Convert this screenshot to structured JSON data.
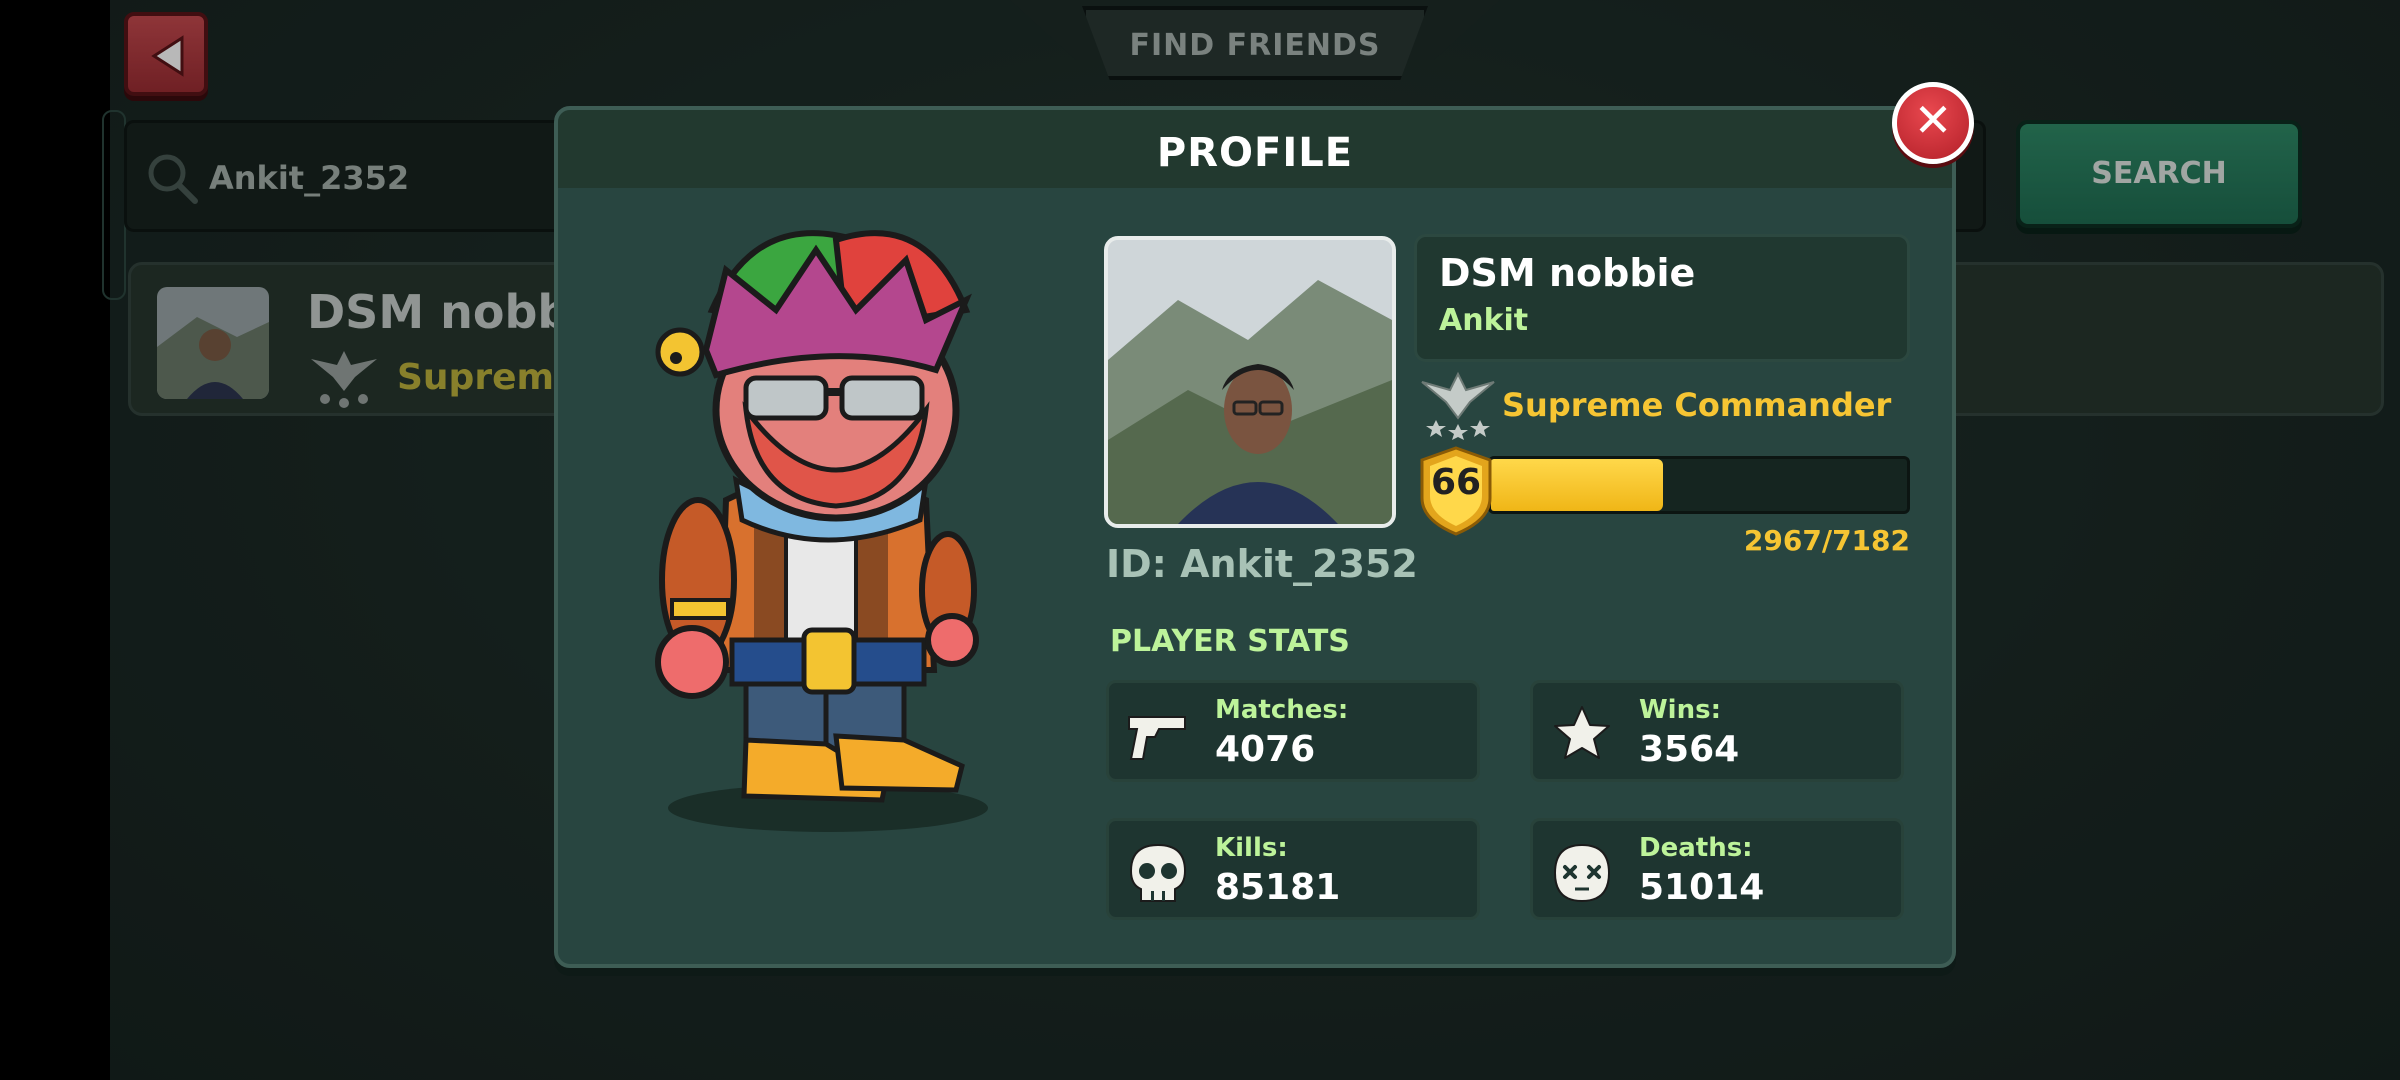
{
  "screen": {
    "title": "FIND FRIENDS",
    "search": {
      "value": "Ankit_2352",
      "button_label": "SEARCH"
    },
    "result": {
      "name": "DSM nobb",
      "rank": "Supreme"
    }
  },
  "profile": {
    "title": "PROFILE",
    "display_name": "DSM nobbie",
    "username": "Ankit",
    "player_id": "ID: Ankit_2352",
    "rank_title": "Supreme Commander",
    "level": "66",
    "xp_text": "2967/7182",
    "xp_fraction": 0.413,
    "stats_title": "PLAYER STATS",
    "stats": [
      {
        "label": "Matches:",
        "value": "4076",
        "icon": "pistol-icon"
      },
      {
        "label": "Wins:",
        "value": "3564",
        "icon": "star-icon"
      },
      {
        "label": "Kills:",
        "value": "85181",
        "icon": "skull-icon"
      },
      {
        "label": "Deaths:",
        "value": "51014",
        "icon": "dead-face-icon"
      }
    ]
  },
  "colors": {
    "accent_green": "#bdf39a",
    "gold": "#f6c533",
    "close_red": "#d7363e",
    "search_green": "#2a7d5e"
  },
  "icons": [
    "back-arrow-icon",
    "search-icon",
    "close-icon",
    "rank-eagle-icon",
    "level-shield-icon"
  ]
}
